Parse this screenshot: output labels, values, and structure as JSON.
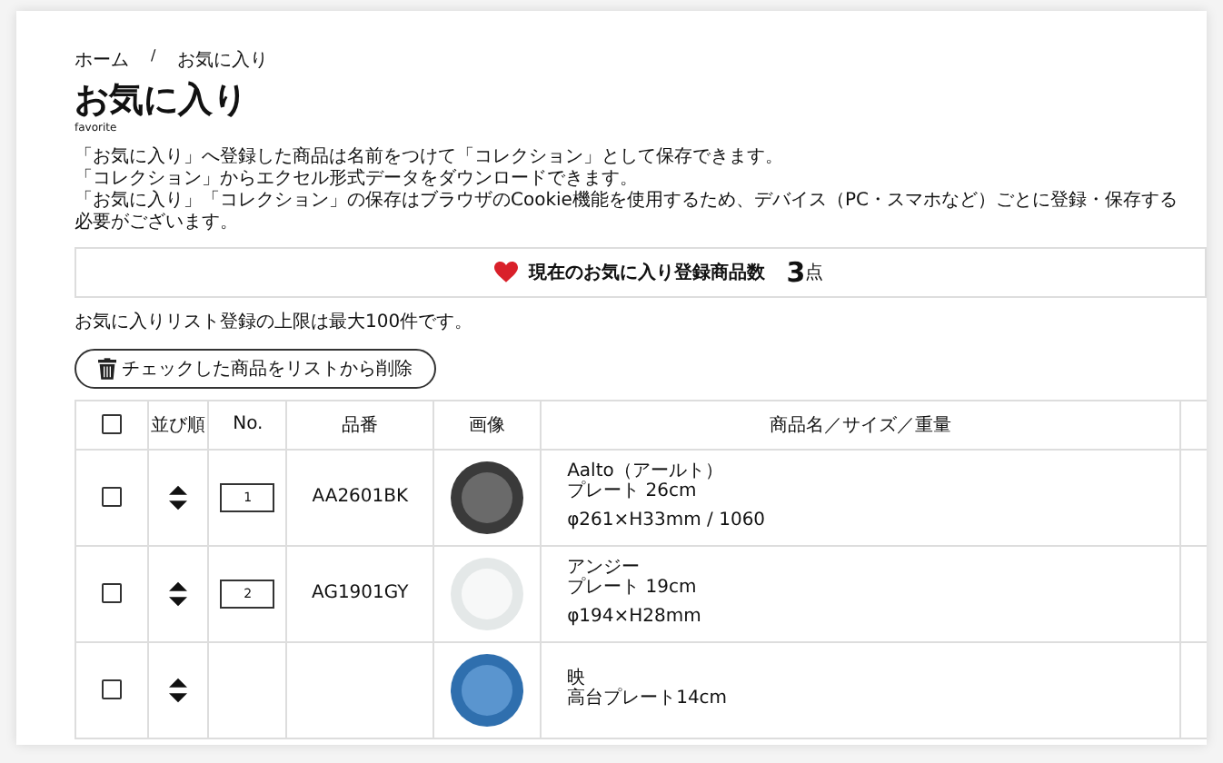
{
  "breadcrumb": {
    "items": [
      "ホーム",
      "お気に入り"
    ],
    "separator": "/"
  },
  "title": "お気に入り",
  "subtitle": "favorite",
  "intro": [
    "「お気に入り」へ登録した商品は名前をつけて「コレクション」として保存できます。",
    "「コレクション」からエクセル形式データをダウンロードできます。",
    "「お気に入り」「コレクション」の保存はブラウザのCookie機能を使用するため、デバイス（PC・スマホなど）ごとに登録・保存する必要がございます。"
  ],
  "summary": {
    "label": "現在のお気に入り登録商品数",
    "count": "3",
    "unit": "点"
  },
  "limit_note": "お気に入りリスト登録の上限は最大100件です。",
  "delete_button": "チェックした商品をリストから削除",
  "table": {
    "select_all_checked": false,
    "columns": [
      "並び順",
      "No.",
      "品番",
      "画像",
      "商品名／サイズ／重量"
    ],
    "rows": [
      {
        "checked": false,
        "no": "1",
        "code": "AA2601BK",
        "kind": "dark",
        "name": [
          "Aalto（アールト）",
          "プレート 26cm"
        ],
        "spec": "φ261×H33mm / 1060"
      },
      {
        "checked": false,
        "no": "2",
        "code": "AG1901GY",
        "kind": "light",
        "name": [
          "アンジー",
          "プレート 19cm"
        ],
        "spec": "φ194×H28mm"
      },
      {
        "checked": false,
        "kind": "blue",
        "name": [
          "映",
          "高台プレート14cm"
        ]
      }
    ]
  }
}
